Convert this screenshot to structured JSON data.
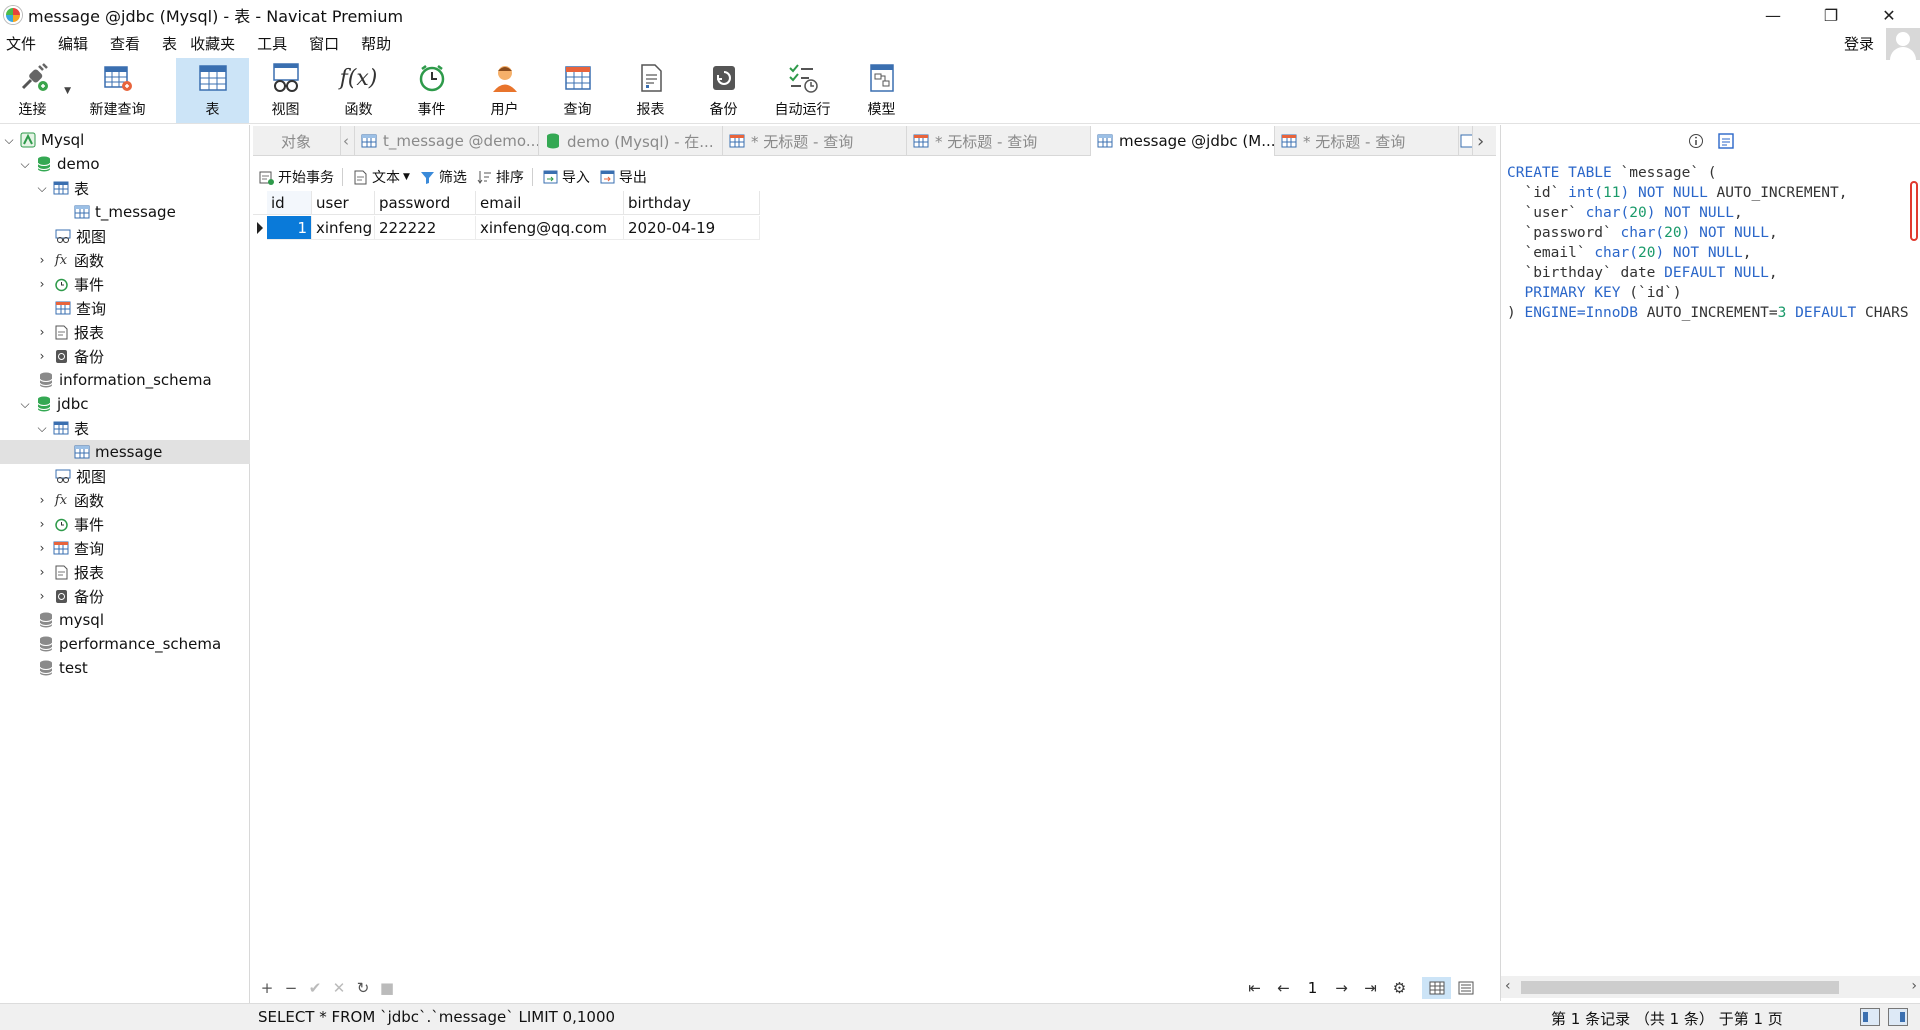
{
  "window": {
    "title": "message @jdbc (Mysql) - 表 - Navicat Premium",
    "controls": {
      "minimize": "—",
      "restore": "❐",
      "close": "✕"
    }
  },
  "menu": [
    "文件",
    "编辑",
    "查看",
    "表",
    "收藏夹",
    "工具",
    "窗口",
    "帮助"
  ],
  "account": {
    "login_label": "登录"
  },
  "toolbar": {
    "connect": "连接",
    "new_query": "新建查询",
    "table": "表",
    "view": "视图",
    "function": "函数",
    "event": "事件",
    "user": "用户",
    "query": "查询",
    "report": "报表",
    "backup": "备份",
    "automation": "自动运行",
    "model": "模型"
  },
  "nav_tree": {
    "mysql": "Mysql",
    "demo": "demo",
    "demo_tables": "表",
    "t_message": "t_message",
    "demo_views": "视图",
    "demo_functions": "函数",
    "demo_events": "事件",
    "demo_queries": "查询",
    "demo_reports": "报表",
    "demo_backups": "备份",
    "information_schema": "information_schema",
    "jdbc": "jdbc",
    "jdbc_tables": "表",
    "message": "message",
    "jdbc_views": "视图",
    "jdbc_functions": "函数",
    "jdbc_events": "事件",
    "jdbc_queries": "查询",
    "jdbc_reports": "报表",
    "jdbc_backups": "备份",
    "mysql_db": "mysql",
    "performance_schema": "performance_schema",
    "test": "test"
  },
  "tabs": {
    "objects": "对象",
    "t1": "t_message @demo...",
    "t2": "demo (Mysql) - 在...",
    "t3": "* 无标题 - 查询",
    "t4": "* 无标题 - 查询",
    "t5": "message @jdbc (M...",
    "t6": "* 无标题 - 查询"
  },
  "grid_toolbar": {
    "begin_transaction": "开始事务",
    "text": "文本",
    "filter": "筛选",
    "sort": "排序",
    "import": "导入",
    "export": "导出"
  },
  "grid": {
    "columns": [
      "id",
      "user",
      "password",
      "email",
      "birthday"
    ],
    "rows": [
      [
        "1",
        "xinfeng",
        "222222",
        "xinfeng@qq.com",
        "2020-04-19"
      ]
    ]
  },
  "grid_footer": {
    "add": "+",
    "remove": "−",
    "apply": "✔",
    "discard": "✕",
    "refresh": "↻",
    "stop": "■",
    "first": "⇤",
    "prev": "←",
    "page": "1",
    "next": "→",
    "last": "⇥",
    "settings": "⚙"
  },
  "ddl": {
    "lines": [
      [
        {
          "k": "CREATE TABLE"
        },
        {
          "t": " `message` ("
        }
      ],
      [
        {
          "t": "  `id` "
        },
        {
          "k": "int("
        },
        {
          "n": "11"
        },
        {
          "k": ")"
        },
        {
          "k": " NOT NULL"
        },
        {
          "t": " AUTO_INCREMENT,"
        }
      ],
      [
        {
          "t": "  `user` "
        },
        {
          "k": "char("
        },
        {
          "n": "20"
        },
        {
          "k": ")"
        },
        {
          "k": " NOT NULL"
        },
        {
          "t": ","
        }
      ],
      [
        {
          "t": "  `password` "
        },
        {
          "k": "char("
        },
        {
          "n": "20"
        },
        {
          "k": ")"
        },
        {
          "k": " NOT NULL"
        },
        {
          "t": ","
        }
      ],
      [
        {
          "t": "  `email` "
        },
        {
          "k": "char("
        },
        {
          "n": "20"
        },
        {
          "k": ")"
        },
        {
          "k": " NOT NULL"
        },
        {
          "t": ","
        }
      ],
      [
        {
          "t": "  `birthday` date "
        },
        {
          "k": "DEFAULT NULL"
        },
        {
          "t": ","
        }
      ],
      [
        {
          "k": "  PRIMARY KEY"
        },
        {
          "t": " (`id`)"
        }
      ],
      [
        {
          "t": ") "
        },
        {
          "k": "ENGINE=InnoDB"
        },
        {
          "t": " AUTO_INCREMENT="
        },
        {
          "n": "3"
        },
        {
          "k": " DEFAULT"
        },
        {
          "t": " CHARS"
        }
      ]
    ]
  },
  "status": {
    "sql": "SELECT * FROM `jdbc`.`message` LIMIT 0,1000",
    "records": "第 1 条记录 （共 1 条） 于第 1 页"
  },
  "colors": {
    "accent_blue": "#0a7ad9",
    "toolbar_active": "#cce4f7",
    "keyword": "#2a66c9",
    "number": "#1a9a6a"
  }
}
